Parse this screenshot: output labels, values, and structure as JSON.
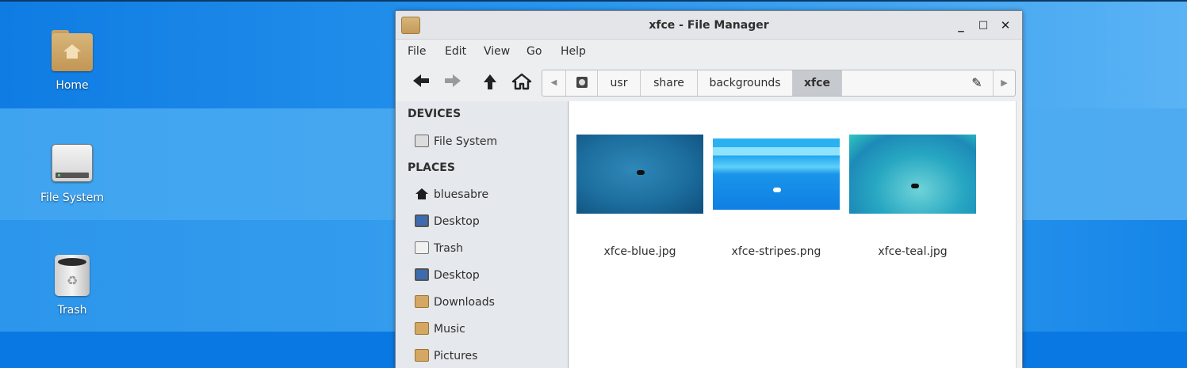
{
  "desktop": {
    "icons": [
      {
        "label": "Home",
        "icon": "home-folder-icon"
      },
      {
        "label": "File System",
        "icon": "drive-icon"
      },
      {
        "label": "Trash",
        "icon": "trash-icon"
      }
    ]
  },
  "window": {
    "title": "xfce - File Manager",
    "controls": {
      "minimize": "_",
      "maximize": "□",
      "close": "✕"
    },
    "menu": [
      "File",
      "Edit",
      "View",
      "Go",
      "Help"
    ],
    "toolbar": {
      "back": "back-arrow-icon",
      "forward": "forward-arrow-icon",
      "up": "up-arrow-icon",
      "home": "home-icon"
    },
    "path": [
      "usr",
      "share",
      "backgrounds",
      "xfce"
    ],
    "active_path": "xfce"
  },
  "sidebar": {
    "devices_heading": "DEVICES",
    "devices": [
      {
        "label": "File System",
        "icon": "drive-icon"
      }
    ],
    "places_heading": "PLACES",
    "places": [
      {
        "label": "bluesabre",
        "icon": "home-icon"
      },
      {
        "label": "Desktop",
        "icon": "desktop-icon"
      },
      {
        "label": "Trash",
        "icon": "trash-icon"
      },
      {
        "label": "Desktop",
        "icon": "desktop-icon"
      },
      {
        "label": "Downloads",
        "icon": "downloads-folder-icon"
      },
      {
        "label": "Music",
        "icon": "music-folder-icon"
      },
      {
        "label": "Pictures",
        "icon": "pictures-folder-icon"
      }
    ]
  },
  "files": [
    {
      "name": "xfce-blue.jpg"
    },
    {
      "name": "xfce-stripes.png"
    },
    {
      "name": "xfce-teal.jpg"
    }
  ],
  "colors": {
    "desktop_blue": "#1a86e6",
    "window_bg": "#edeef0",
    "content_bg": "#ffffff"
  }
}
